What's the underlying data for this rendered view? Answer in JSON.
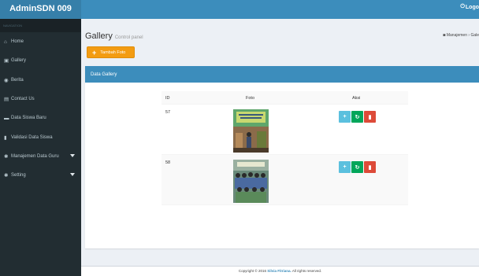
{
  "header": {
    "brand": "AdminSDN 009",
    "logout": "Logo",
    "logout_icon": "power-icon",
    "accent": "#3c8dbc"
  },
  "sidebar": {
    "section": "NAVIGATION",
    "items": [
      {
        "label": "Home",
        "icon": "home-icon"
      },
      {
        "label": "Gallery",
        "icon": "image-icon"
      },
      {
        "label": "Berita",
        "icon": "globe-icon"
      },
      {
        "label": "Contact Us",
        "icon": "contact-icon"
      },
      {
        "label": "Data Siswa Baru",
        "icon": "folder-icon"
      },
      {
        "label": "Validasi Data Siswa",
        "icon": "file-icon"
      },
      {
        "label": "Manajemen Data Guru",
        "icon": "gear-icon"
      },
      {
        "label": "Setting",
        "icon": "gear-icon"
      }
    ]
  },
  "main": {
    "title": "Gallery",
    "subtitle": "Control panel",
    "breadcrumb": [
      "Manajemen",
      "Gale"
    ],
    "add_button": "Tambah Foto",
    "box_title": "Data Gallery",
    "table": {
      "columns": [
        "ID",
        "Foto",
        "Aksi"
      ],
      "rows": [
        {
          "id": "57"
        },
        {
          "id": "58"
        }
      ]
    },
    "action_icons": [
      "plus-icon",
      "refresh-icon",
      "trash-icon"
    ],
    "action_colors": [
      "#5bc0de",
      "#00a65a",
      "#dd4b39"
    ]
  },
  "footer": {
    "prefix": "Copyright © 2016",
    "author": "Silvia Fitriana.",
    "suffix": "All rights reserved."
  }
}
